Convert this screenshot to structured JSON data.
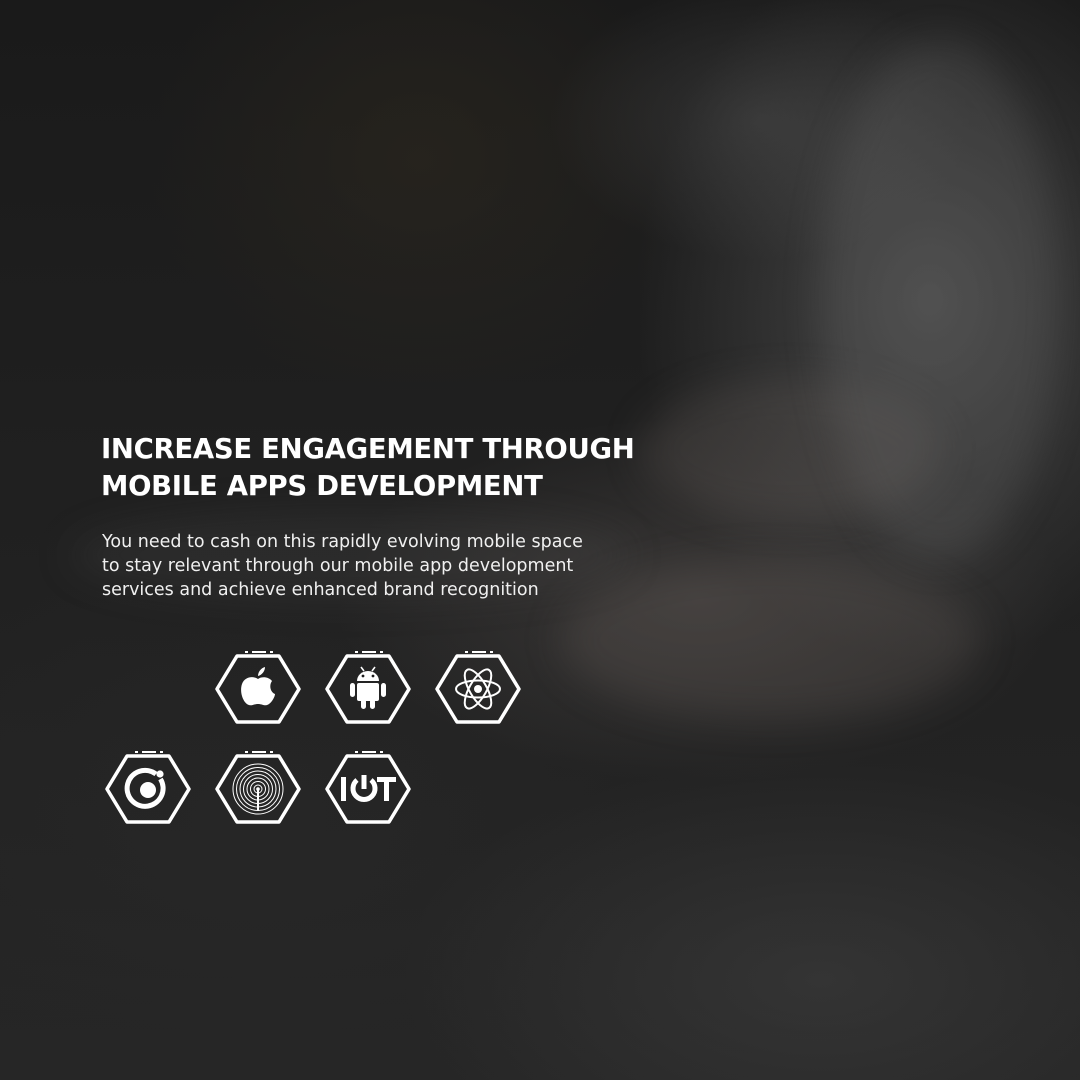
{
  "hero": {
    "headline_lines": [
      "INCREASE ENGAGEMENT THROUGH",
      "MOBILE APPS DEVELOPMENT"
    ],
    "body_lines": [
      "You need to cash on this rapidly evolving mobile space",
      "to stay relevant through our mobile app development",
      "services and achieve enhanced brand recognition"
    ]
  },
  "tech_icons": [
    {
      "icon": "apple-icon"
    },
    {
      "icon": "android-icon"
    },
    {
      "icon": "react-icon"
    },
    {
      "icon": "ionic-icon"
    },
    {
      "icon": "wireless-signal-icon"
    },
    {
      "icon": "iot-icon",
      "text": "IoT"
    }
  ],
  "colors": {
    "text": "#ffffff",
    "icon_stroke": "#ffffff",
    "background": "#1c1c1c"
  }
}
